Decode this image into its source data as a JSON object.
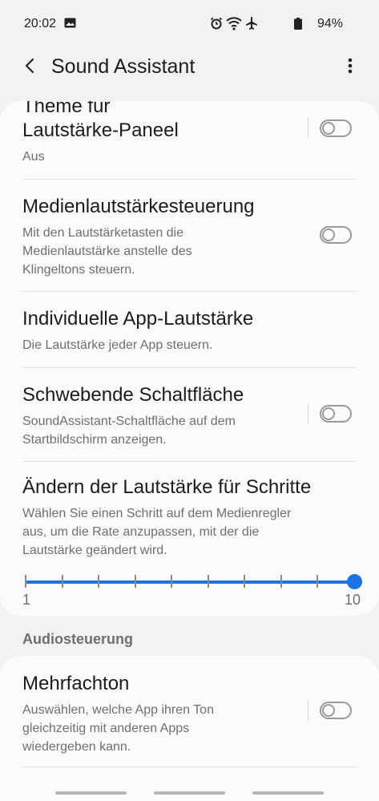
{
  "status_bar": {
    "time": "20:02",
    "battery": "94%",
    "icons": [
      "image-icon",
      "alarm-icon",
      "wifi-icon",
      "airplane-icon",
      "battery-icon"
    ]
  },
  "app_bar": {
    "title": "Sound Assistant",
    "back_icon": "back-arrow-icon",
    "more_icon": "more-vertical-icon"
  },
  "settings": [
    {
      "title_line1": "Theme für",
      "title_line2": "Lautstärke-Paneel",
      "subtitle": "Aus",
      "toggle": false
    },
    {
      "title": "Medienlautstärkesteuerung",
      "subtitle_lines": [
        "Mit den Lautstärketasten die",
        "Medienlautstärke anstelle des",
        "Klingeltons steuern."
      ],
      "toggle": false
    },
    {
      "title": "Individuelle App-Lautstärke",
      "subtitle": "Die Lautstärke jeder App steuern."
    },
    {
      "title": "Schwebende Schaltfläche",
      "subtitle_lines": [
        "SoundAssistant-Schaltfläche auf dem",
        "Startbildschirm anzeigen."
      ],
      "toggle": false
    },
    {
      "title": "Ändern der Lautstärke für Schritte",
      "subtitle_lines": [
        "Wählen Sie einen Schritt auf dem Medienregler",
        "aus, um die Rate anzupassen, mit der die",
        "Lautstärke geändert wird."
      ],
      "slider": {
        "min_label": "1",
        "max_label": "10",
        "value": 10,
        "min": 1,
        "max": 10
      }
    }
  ],
  "section": {
    "header": "Audiosteuerung",
    "items": [
      {
        "title": "Mehrfachton",
        "subtitle_lines": [
          "Auswählen, welche App ihren Ton",
          "gleichzeitig mit anderen Apps",
          "wiedergeben kann."
        ],
        "toggle": false
      }
    ]
  },
  "colors": {
    "accent": "#1a73e8",
    "background": "#f2f2f2",
    "card": "#fbfbfb"
  }
}
